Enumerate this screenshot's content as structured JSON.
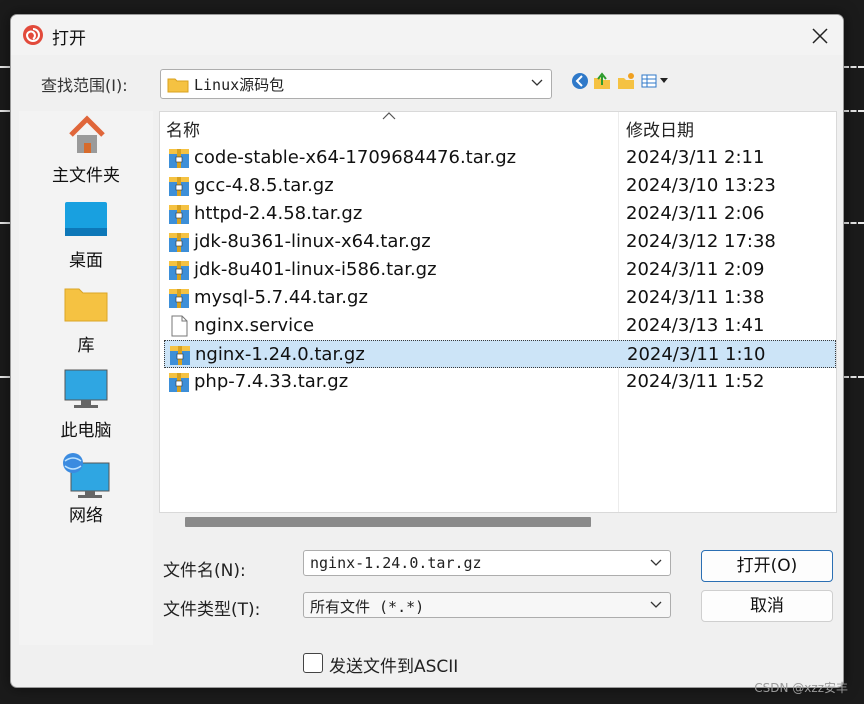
{
  "dialog": {
    "title": "打开",
    "look_in": {
      "label": "查找范围(I):",
      "value": "Linux源码包"
    },
    "places": [
      {
        "label": "主文件夹",
        "icon": "home-icon"
      },
      {
        "label": "桌面",
        "icon": "desktop-icon"
      },
      {
        "label": "库",
        "icon": "library-folder-icon"
      },
      {
        "label": "此电脑",
        "icon": "computer-icon"
      },
      {
        "label": "网络",
        "icon": "network-icon"
      }
    ],
    "columns": {
      "name": "名称",
      "date": "修改日期"
    },
    "files": [
      {
        "name": "code-stable-x64-1709684476.tar.gz",
        "date": "2024/3/11 2:11",
        "type": "archive"
      },
      {
        "name": "gcc-4.8.5.tar.gz",
        "date": "2024/3/10 13:23",
        "type": "archive"
      },
      {
        "name": "httpd-2.4.58.tar.gz",
        "date": "2024/3/11 2:06",
        "type": "archive"
      },
      {
        "name": "jdk-8u361-linux-x64.tar.gz",
        "date": "2024/3/12 17:38",
        "type": "archive"
      },
      {
        "name": "jdk-8u401-linux-i586.tar.gz",
        "date": "2024/3/11 2:09",
        "type": "archive"
      },
      {
        "name": "mysql-5.7.44.tar.gz",
        "date": "2024/3/11 1:38",
        "type": "archive"
      },
      {
        "name": "nginx.service",
        "date": "2024/3/13 1:41",
        "type": "file"
      },
      {
        "name": "nginx-1.24.0.tar.gz",
        "date": "2024/3/11 1:10",
        "type": "archive",
        "selected": true
      },
      {
        "name": "php-7.4.33.tar.gz",
        "date": "2024/3/11 1:52",
        "type": "archive"
      }
    ],
    "filename": {
      "label": "文件名(N):",
      "value": "nginx-1.24.0.tar.gz"
    },
    "filetype": {
      "label": "文件类型(T):",
      "value": "所有文件 (*.*)"
    },
    "buttons": {
      "open": "打开(O)",
      "cancel": "取消"
    },
    "ascii_checkbox": {
      "label": "发送文件到ASCII",
      "checked": false
    }
  },
  "watermark": "CSDN @xzz安丰",
  "colors": {
    "selection": "#cce4f7",
    "primary_border": "#2b6fb3",
    "folder": "#f5c242"
  }
}
